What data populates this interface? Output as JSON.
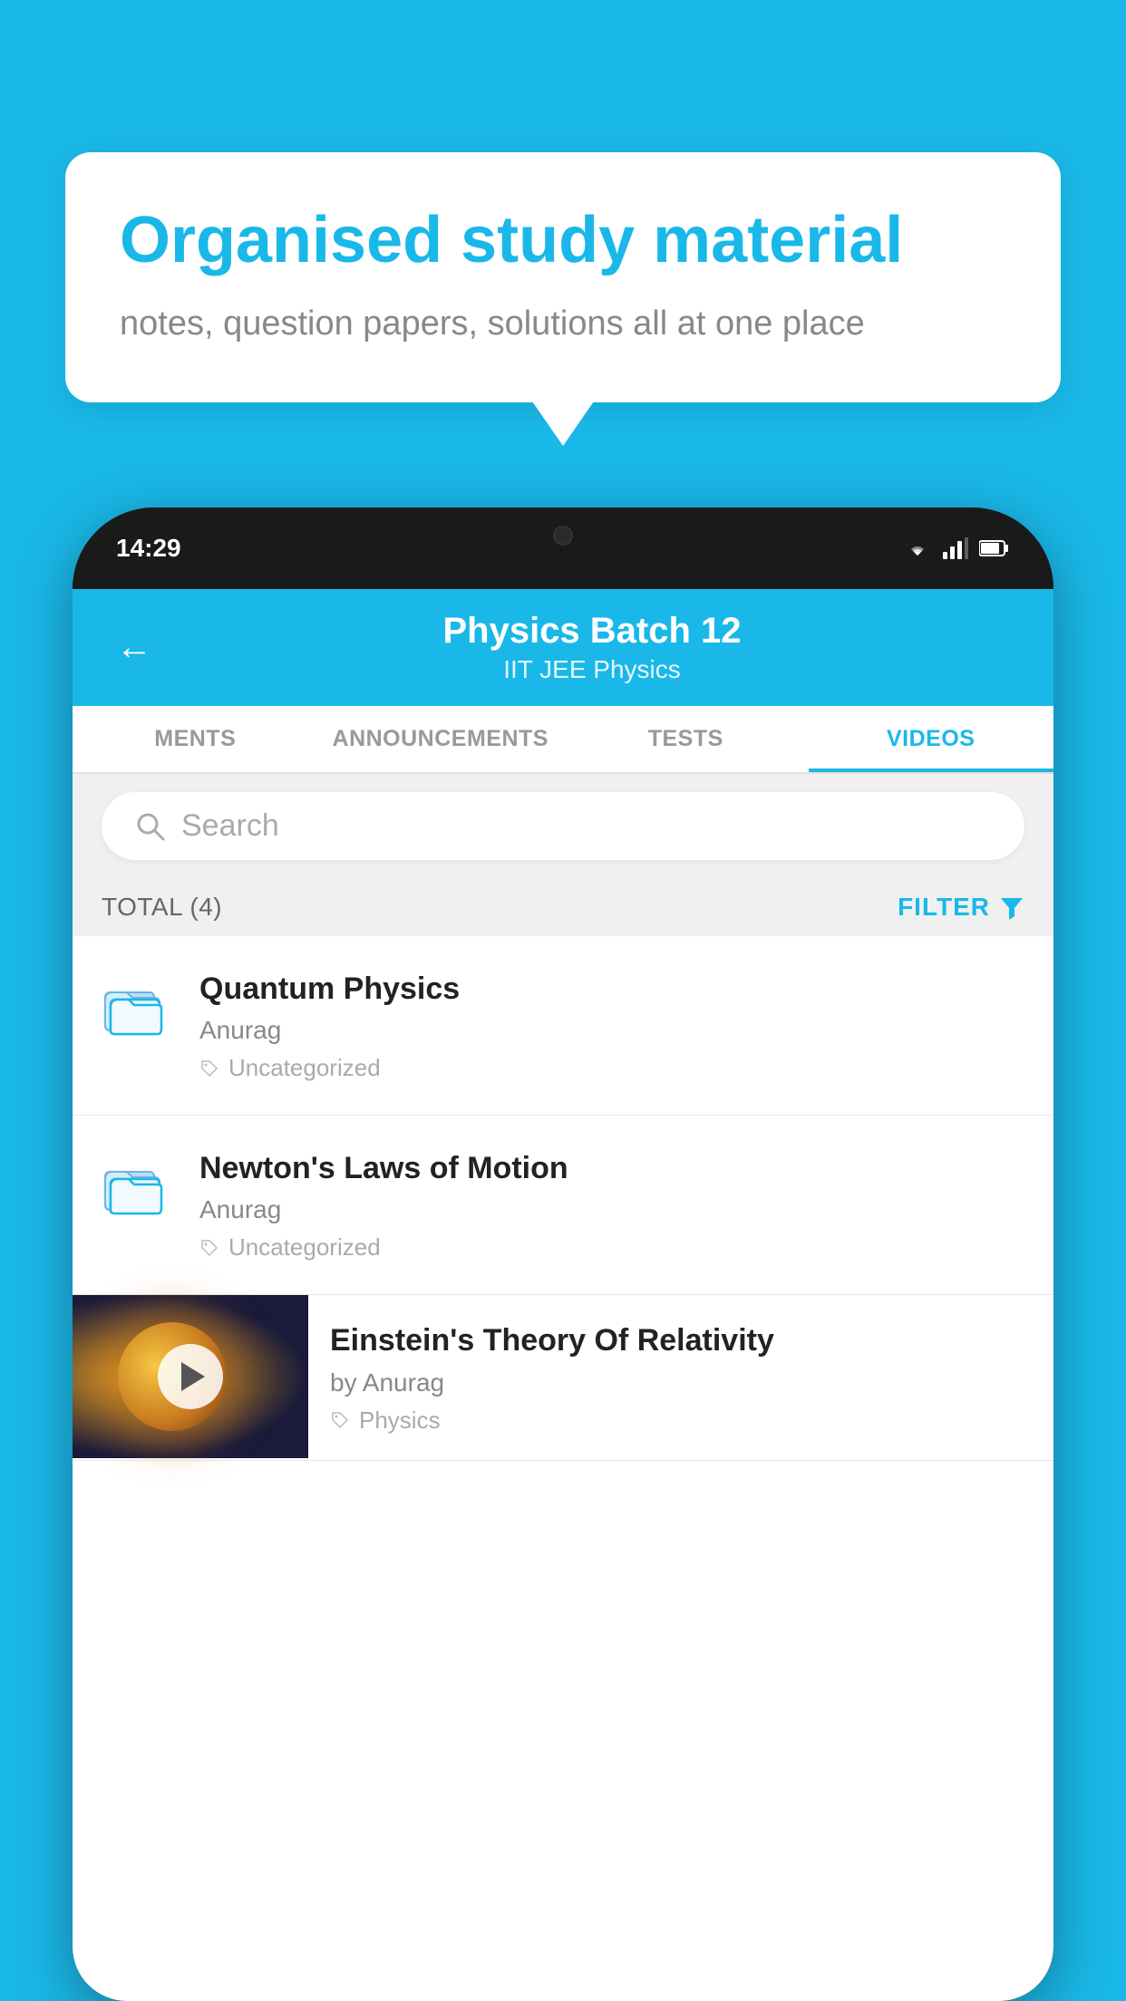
{
  "background": {
    "color": "#1ab8e8"
  },
  "bubble": {
    "title": "Organised study material",
    "subtitle": "notes, question papers, solutions all at one place"
  },
  "phone": {
    "status_bar": {
      "time": "14:29",
      "wifi_icon": "wifi",
      "signal_icon": "signal",
      "battery_icon": "battery"
    },
    "header": {
      "back_label": "←",
      "title": "Physics Batch 12",
      "subtitle_tags": "IIT JEE   Physics"
    },
    "tabs": [
      {
        "label": "MENTS",
        "active": false
      },
      {
        "label": "ANNOUNCEMENTS",
        "active": false
      },
      {
        "label": "TESTS",
        "active": false
      },
      {
        "label": "VIDEOS",
        "active": true
      }
    ],
    "search": {
      "placeholder": "Search"
    },
    "filter": {
      "total_label": "TOTAL (4)",
      "button_label": "FILTER"
    },
    "videos": [
      {
        "title": "Quantum Physics",
        "author": "Anurag",
        "tag": "Uncategorized",
        "has_thumbnail": false
      },
      {
        "title": "Newton's Laws of Motion",
        "author": "Anurag",
        "tag": "Uncategorized",
        "has_thumbnail": false
      },
      {
        "title": "Einstein's Theory Of Relativity",
        "author": "by Anurag",
        "tag": "Physics",
        "has_thumbnail": true
      }
    ]
  }
}
